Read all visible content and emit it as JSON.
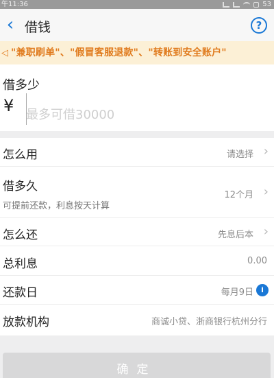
{
  "status_bar": {
    "time": "午11:36",
    "battery": "53"
  },
  "nav": {
    "back_icon": "‹",
    "title": "借钱",
    "help_icon": "?"
  },
  "notice": {
    "text": "\"兼职刷单\"、\"假冒客服退款\"、\"转账到安全账户\""
  },
  "amount": {
    "label": "借多少",
    "currency": "¥",
    "placeholder": "最多可借30000"
  },
  "rows": [
    {
      "label": "怎么用",
      "value": "请选择"
    },
    {
      "label": "借多久",
      "sub": "可提前还款，利息按天计算",
      "value": "12个月"
    },
    {
      "label": "怎么还",
      "value": "先息后本"
    },
    {
      "label": "总利息",
      "value": "0.00"
    },
    {
      "label": "还款日",
      "value": "每月9日"
    },
    {
      "label": "放款机构",
      "value": "商诚小贷、浙商银行杭州分行"
    }
  ],
  "confirm_label": "确定",
  "colors": {
    "accent": "#1a78d6",
    "notice_text": "#e07b1e",
    "notice_bg": "#fcf0d6"
  }
}
